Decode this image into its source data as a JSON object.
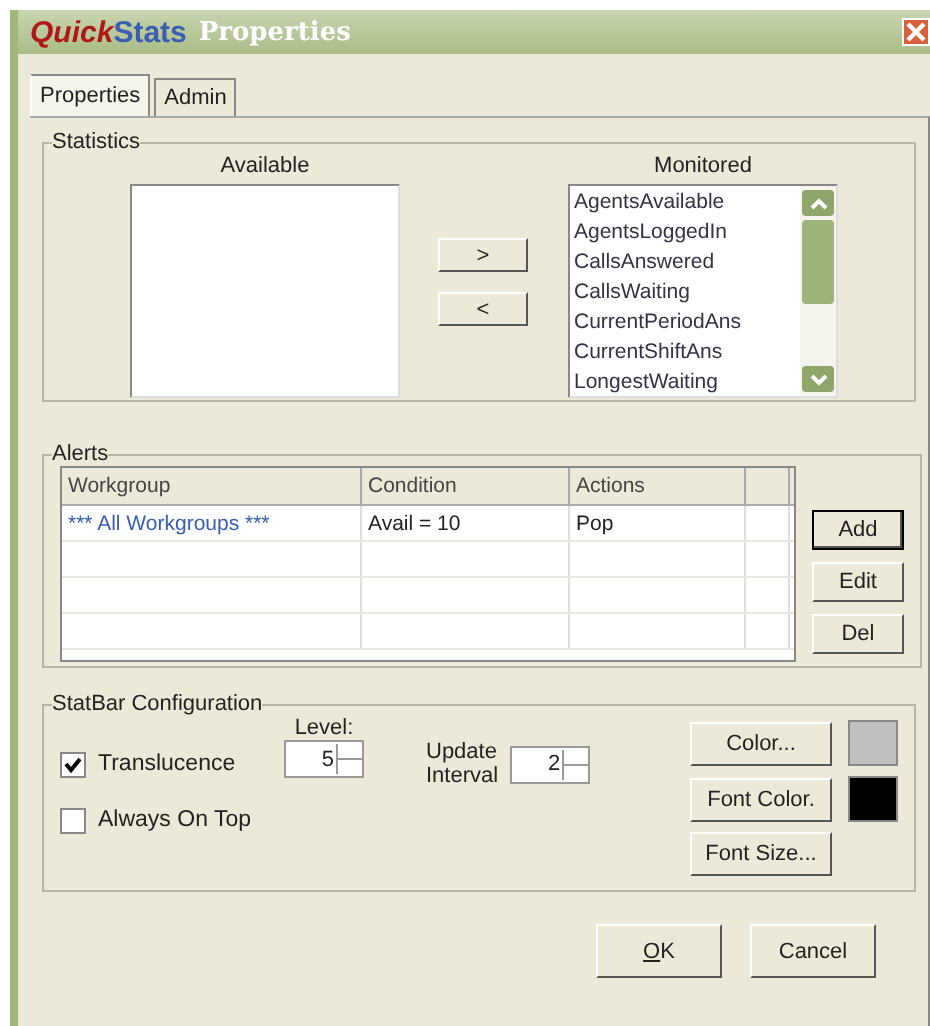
{
  "window": {
    "brand_part_1": "Quick",
    "brand_part_2": "Stats",
    "title": "Properties"
  },
  "tabs": [
    {
      "label": "Properties",
      "selected": true
    },
    {
      "label": "Admin",
      "selected": false
    }
  ],
  "statistics": {
    "title": "Statistics",
    "available_label": "Available",
    "monitored_label": "Monitored",
    "add_button": ">",
    "remove_button": "<",
    "monitored": [
      "AgentsAvailable",
      "AgentsLoggedIn",
      "CallsAnswered",
      "CallsWaiting",
      "CurrentPeriodAns",
      "CurrentShiftAns",
      "LongestWaiting"
    ]
  },
  "alerts": {
    "title": "Alerts",
    "columns": [
      "Workgroup",
      "Condition",
      "Actions"
    ],
    "rows": [
      [
        "*** All Workgroups ***",
        "Avail = 10",
        "Pop"
      ]
    ],
    "buttons": [
      "Add",
      "Edit",
      "Del"
    ]
  },
  "statbar": {
    "title": "StatBar Configuration",
    "translucence": {
      "label": "Translucence",
      "checked": true
    },
    "level": {
      "label": "Level:",
      "value": "5"
    },
    "update_interval": {
      "label_line_1": "Update",
      "label_line_2": "Interval",
      "value": "2"
    },
    "always_on_top": {
      "label": "Always On Top",
      "checked": false
    },
    "color_buttons": [
      {
        "label": "Color...",
        "color": "#c0c0c0"
      },
      {
        "label": "Font Color.",
        "color": "#000000"
      },
      {
        "label": "Font Size..."
      }
    ]
  },
  "buttons": [
    {
      "mnemonic": "O",
      "label_rest": "K"
    },
    {
      "label": "Cancel"
    }
  ]
}
